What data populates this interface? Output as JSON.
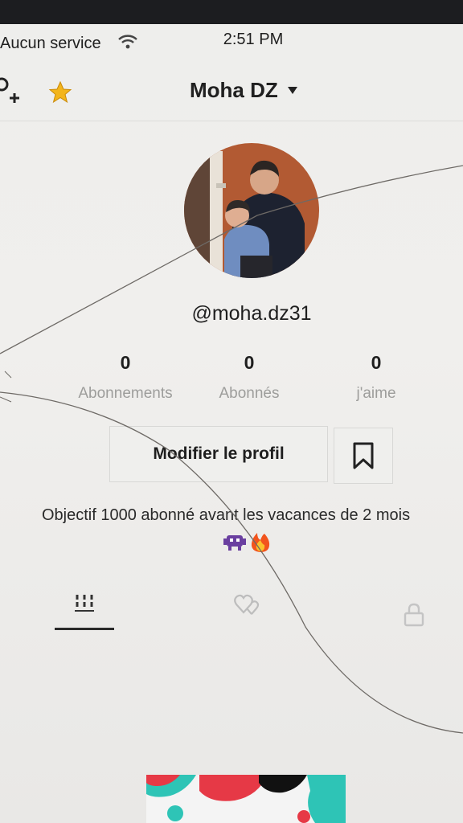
{
  "status_bar": {
    "carrier": "Aucun service",
    "time": "2:51 PM"
  },
  "nav": {
    "account_name": "Moha DZ"
  },
  "profile": {
    "username": "@moha.dz31",
    "stats": [
      {
        "value": "0",
        "label": "Abonnements"
      },
      {
        "value": "0",
        "label": "Abonnés"
      },
      {
        "value": "0",
        "label": "j'aime"
      }
    ],
    "edit_button_label": "Modifier le profil",
    "bio": "Objectif 1000 abonné avant les vacances de 2 mois",
    "bio_emojis": [
      "alien-monster-emoji",
      "fire-emoji"
    ]
  },
  "tabs": [
    {
      "icon": "grid-icon",
      "selected": true
    },
    {
      "icon": "liked-hearts-icon",
      "selected": false
    },
    {
      "icon": "lock-icon",
      "selected": false
    }
  ],
  "colors": {
    "accent_star": "#f3b51b",
    "text": "#1e1e1e",
    "muted": "#9d9d9b",
    "divider": "#dcdcda"
  }
}
